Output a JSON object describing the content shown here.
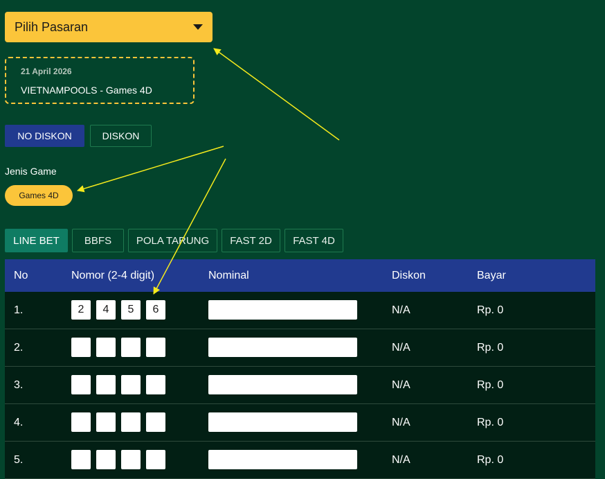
{
  "market_select": {
    "label": "Pilih Pasaran"
  },
  "info": {
    "date": "21 April 2026",
    "market": "VIETNAMPOOLS - Games 4D"
  },
  "discount_buttons": {
    "no_diskon": "NO DISKON",
    "diskon": "DISKON"
  },
  "jenis_game": {
    "label": "Jenis Game",
    "selected": "Games 4D"
  },
  "tabs": [
    "LINE BET",
    "BBFS",
    "POLA TARUNG",
    "FAST 2D",
    "FAST 4D"
  ],
  "table": {
    "headers": {
      "no": "No",
      "nomor": "Nomor (2-4 digit)",
      "nominal": "Nominal",
      "diskon": "Diskon",
      "bayar": "Bayar"
    },
    "rows": [
      {
        "no": "1.",
        "digits": [
          "2",
          "4",
          "5",
          "6"
        ],
        "nominal": "",
        "diskon": "N/A",
        "bayar": "Rp. 0"
      },
      {
        "no": "2.",
        "digits": [
          "",
          "",
          "",
          ""
        ],
        "nominal": "",
        "diskon": "N/A",
        "bayar": "Rp. 0"
      },
      {
        "no": "3.",
        "digits": [
          "",
          "",
          "",
          ""
        ],
        "nominal": "",
        "diskon": "N/A",
        "bayar": "Rp. 0"
      },
      {
        "no": "4.",
        "digits": [
          "",
          "",
          "",
          ""
        ],
        "nominal": "",
        "diskon": "N/A",
        "bayar": "Rp. 0"
      },
      {
        "no": "5.",
        "digits": [
          "",
          "",
          "",
          ""
        ],
        "nominal": "",
        "diskon": "N/A",
        "bayar": "Rp. 0"
      }
    ]
  },
  "colors": {
    "background": "#03442c",
    "accent": "#fbc53a",
    "primary": "#213a8f",
    "active_tab": "#0f7c63",
    "annotation": "#f5ea1c"
  }
}
